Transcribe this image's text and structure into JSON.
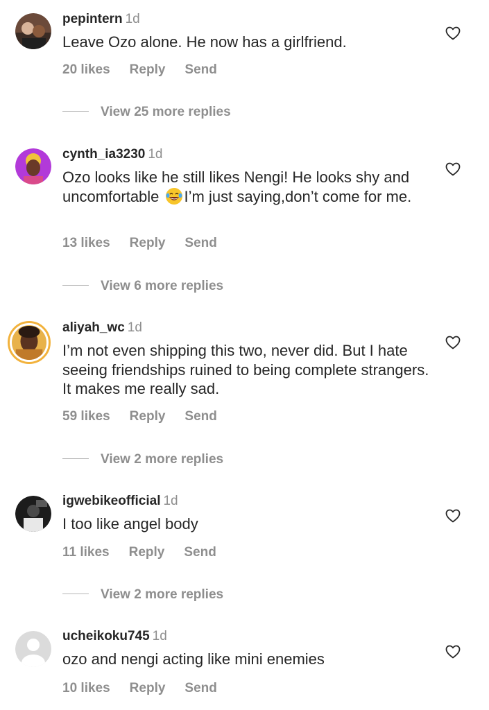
{
  "comments": [
    {
      "username": "pepintern",
      "time": "1d",
      "text": "Leave Ozo alone. He now has a girlfriend.",
      "likes": "20 likes",
      "reply": "Reply",
      "send": "Send",
      "view_more": "View 25 more replies"
    },
    {
      "username": "cynth_ia3230",
      "time": "1d",
      "text_before": "Ozo looks like he still likes Nengi! He looks shy and uncomfortable ",
      "emoji": "face-with-tears-of-joy",
      "text_after": "I’m just saying,don’t come for me.",
      "likes": "13 likes",
      "reply": "Reply",
      "send": "Send",
      "view_more": "View 6 more replies"
    },
    {
      "username": "aliyah_wc",
      "time": "1d",
      "text": "I’m not even shipping this two, never did. But I hate seeing friendships ruined to being complete strangers. It makes me really sad.",
      "likes": "59 likes",
      "reply": "Reply",
      "send": "Send",
      "view_more": "View 2 more replies"
    },
    {
      "username": "igwebikeofficial",
      "time": "1d",
      "text": "I too like angel body",
      "likes": "11 likes",
      "reply": "Reply",
      "send": "Send",
      "view_more": "View 2 more replies"
    },
    {
      "username": "ucheikoku745",
      "time": "1d",
      "text": "ozo and nengi acting like mini enemies",
      "likes": "10 likes",
      "reply": "Reply",
      "send": "Send"
    }
  ],
  "colors": {
    "text": "#262626",
    "muted": "#8e8e8e",
    "story_ring": "#f2b23c"
  },
  "icons": {
    "like": "heart-outline-icon",
    "default_avatar": "default-avatar-icon"
  }
}
